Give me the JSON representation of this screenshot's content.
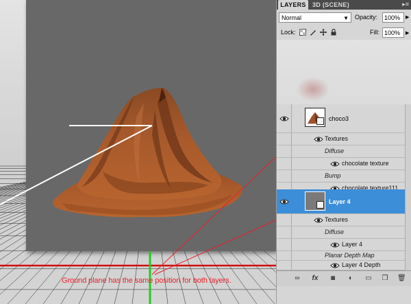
{
  "viewport": {
    "caption": "Ground plane has the same position for both layers.",
    "colors": {
      "ground_line": "#d01010",
      "axis_line": "#22cc22",
      "annotation": "#e8202a",
      "highlight": "#ffffff"
    }
  },
  "panel": {
    "tabs": [
      {
        "label": "LAYERS",
        "active": true
      },
      {
        "label": "3D (SCENE)",
        "active": false
      }
    ],
    "menu_icon": "panel-menu-icon",
    "blend_mode": "Normal",
    "opacity_label": "Opacity:",
    "opacity_value": "100%",
    "lock_label": "Lock:",
    "fill_label": "Fill:",
    "fill_value": "100%",
    "layers": [
      {
        "name": "choco3",
        "selected": false,
        "children": [
          {
            "label": "Textures",
            "kind": "group"
          },
          {
            "label": "Diffuse",
            "kind": "map"
          },
          {
            "label": "chocolate texture",
            "kind": "texture"
          },
          {
            "label": "Bump",
            "kind": "map"
          },
          {
            "label": "chocolate texture111",
            "kind": "texture"
          }
        ]
      },
      {
        "name": "Layer 4",
        "selected": true,
        "children": [
          {
            "label": "Textures",
            "kind": "group"
          },
          {
            "label": "Diffuse",
            "kind": "map"
          },
          {
            "label": "Layer 4",
            "kind": "texture"
          },
          {
            "label": "Planar Depth Map",
            "kind": "map"
          },
          {
            "label": "Layer 4 Depth",
            "kind": "texture"
          }
        ]
      }
    ],
    "footer_icons": [
      "link-icon",
      "fx-icon",
      "mask-icon",
      "adjustment-icon",
      "group-icon",
      "new-layer-icon",
      "trash-icon"
    ],
    "selection_color": "#3d8ed8"
  }
}
